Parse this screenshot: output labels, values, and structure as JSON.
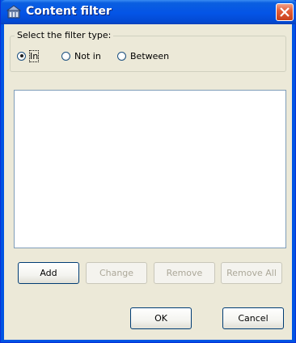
{
  "window": {
    "title": "Content filter",
    "close_icon": "close-icon"
  },
  "filter_type": {
    "group_label": "Select the filter type:",
    "options": [
      {
        "label": "In",
        "checked": true
      },
      {
        "label": "Not in",
        "checked": false
      },
      {
        "label": "Between",
        "checked": false
      }
    ]
  },
  "list": {
    "items": []
  },
  "buttons": {
    "add": "Add",
    "change": "Change",
    "remove": "Remove",
    "remove_all": "Remove All",
    "ok": "OK",
    "cancel": "Cancel"
  },
  "colors": {
    "titlebar": "#0454e6",
    "dialog_bg": "#ece9d8",
    "close_button": "#e35f3a"
  }
}
